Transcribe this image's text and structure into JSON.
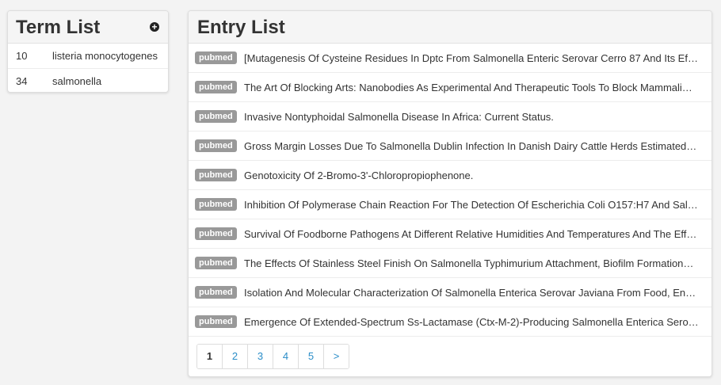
{
  "term_list": {
    "title": "Term List",
    "add_icon": "plus-circle-icon",
    "items": [
      {
        "count": "10",
        "term": "listeria monocytogenes"
      },
      {
        "count": "34",
        "term": "salmonella"
      }
    ]
  },
  "entry_list": {
    "title": "Entry List",
    "items": [
      {
        "source": "pubmed",
        "title": "[Mutagenesis Of Cysteine Residues In Dptc From Salmonella Enteric Serovar Cerro 87 And Its Ef…"
      },
      {
        "source": "pubmed",
        "title": "The Art Of Blocking Arts: Nanobodies As Experimental And Therapeutic Tools To Block Mammali…"
      },
      {
        "source": "pubmed",
        "title": "Invasive Nontyphoidal Salmonella Disease In Africa: Current Status."
      },
      {
        "source": "pubmed",
        "title": "Gross Margin Losses Due To Salmonella Dublin Infection In Danish Dairy Cattle Herds Estimated…"
      },
      {
        "source": "pubmed",
        "title": "Genotoxicity Of 2-Bromo-3'-Chloropropiophenone."
      },
      {
        "source": "pubmed",
        "title": "Inhibition Of Polymerase Chain Reaction For The Detection Of Escherichia Coli O157:H7 And Sal…"
      },
      {
        "source": "pubmed",
        "title": "Survival Of Foodborne Pathogens At Different Relative Humidities And Temperatures And The Eff…"
      },
      {
        "source": "pubmed",
        "title": "The Effects Of Stainless Steel Finish On Salmonella Typhimurium Attachment, Biofilm Formation…"
      },
      {
        "source": "pubmed",
        "title": "Isolation And Molecular Characterization Of Salmonella Enterica Serovar Javiana From Food, En…"
      },
      {
        "source": "pubmed",
        "title": "Emergence Of Extended-Spectrum Ss-Lactamase (Ctx-M-2)-Producing Salmonella Enterica Sero…"
      }
    ],
    "pagination": {
      "pages": [
        "1",
        "2",
        "3",
        "4",
        "5",
        ">"
      ],
      "current": "1"
    }
  },
  "colors": {
    "background": "#f3f3f3",
    "badge": "#999999",
    "link": "#2a8dc8"
  }
}
